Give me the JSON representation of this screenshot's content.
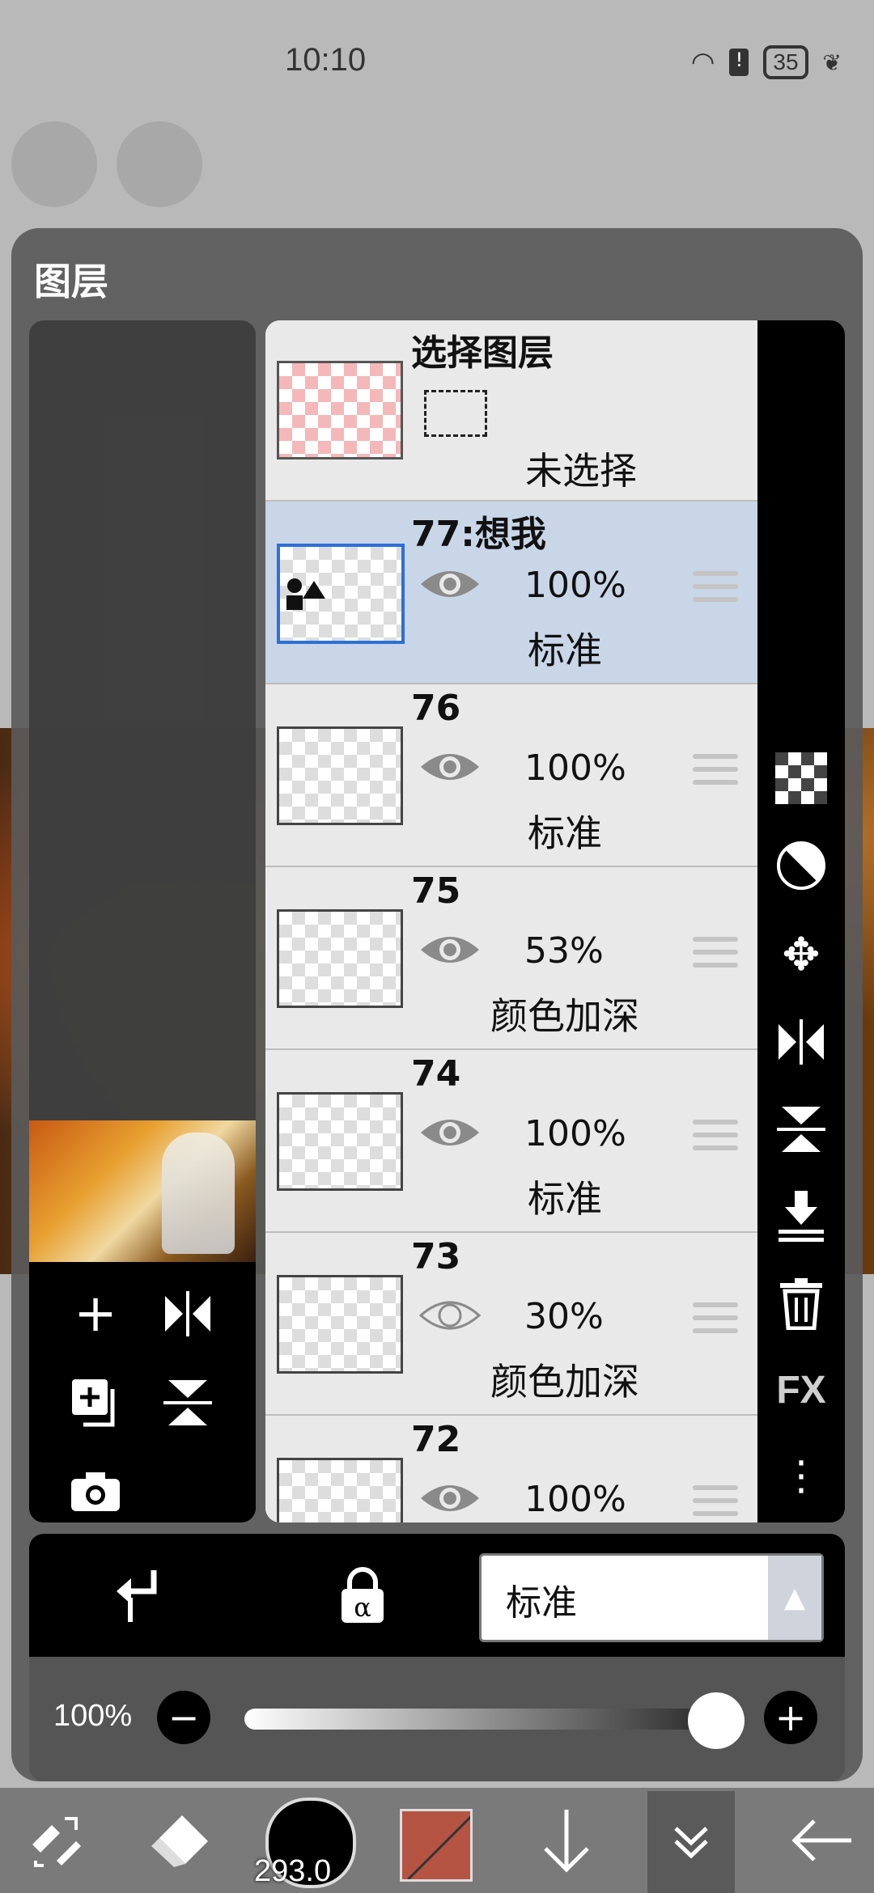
{
  "status_bar": {
    "time": "10:10",
    "battery": "35"
  },
  "panel": {
    "title": "图层"
  },
  "selection_layer": {
    "title": "选择图层",
    "status": "未选择"
  },
  "layers": [
    {
      "name": "77:想我",
      "opacity": "100%",
      "blend": "标准",
      "visible": true,
      "selected": true
    },
    {
      "name": "76",
      "opacity": "100%",
      "blend": "标准",
      "visible": true,
      "selected": false
    },
    {
      "name": "75",
      "opacity": "53%",
      "blend": "颜色加深",
      "visible": true,
      "selected": false
    },
    {
      "name": "74",
      "opacity": "100%",
      "blend": "标准",
      "visible": true,
      "selected": false
    },
    {
      "name": "73",
      "opacity": "30%",
      "blend": "颜色加深",
      "visible": false,
      "selected": false
    },
    {
      "name": "72",
      "opacity": "100%",
      "blend": "",
      "visible": true,
      "selected": false
    }
  ],
  "right_tools": {
    "fx_label": "FX"
  },
  "blend_mode": {
    "value": "标准"
  },
  "opacity_slider": {
    "label": "100%",
    "level": 1.0
  },
  "toolbar": {
    "brush_size": "293.0",
    "color": "#b55443"
  },
  "icons": [
    "add-layer-icon",
    "flip-horizontal-icon",
    "duplicate-layer-icon",
    "flip-vertical-icon",
    "camera-icon",
    "transparency-icon",
    "invert-icon",
    "move-icon",
    "merge-down-icon",
    "delete-icon",
    "more-icon",
    "clipping-icon",
    "alpha-lock-icon",
    "eraser-icon",
    "select-tool-icon",
    "arrow-down-icon",
    "collapse-icon",
    "back-icon"
  ]
}
